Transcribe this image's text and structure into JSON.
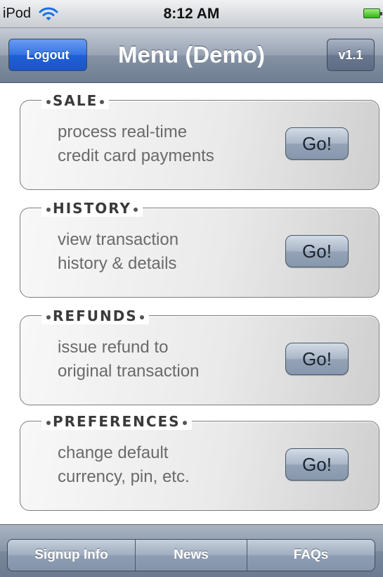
{
  "status_bar": {
    "carrier": "iPod",
    "time": "8:12 AM",
    "wifi_icon": "wifi-icon",
    "battery_icon": "battery-full-icon",
    "battery_color": "#35b21a"
  },
  "nav_bar": {
    "title": "Menu (Demo)",
    "logout_label": "Logout",
    "version_label": "v1.1",
    "logout_color": "#2a66dc"
  },
  "menu": {
    "items": [
      {
        "heading": "SALE",
        "line1": "process real-time",
        "line2": "credit card payments",
        "button": "Go!"
      },
      {
        "heading": "HISTORY",
        "line1": "view transaction",
        "line2": "history & details",
        "button": "Go!"
      },
      {
        "heading": "REFUNDS",
        "line1": "issue refund to",
        "line2": "original transaction",
        "button": "Go!"
      },
      {
        "heading": "PREFERENCES",
        "line1": "change default",
        "line2": "currency, pin, etc.",
        "button": "Go!"
      }
    ]
  },
  "toolbar": {
    "segments": [
      {
        "label": "Signup Info"
      },
      {
        "label": "News"
      },
      {
        "label": "FAQs"
      }
    ]
  }
}
